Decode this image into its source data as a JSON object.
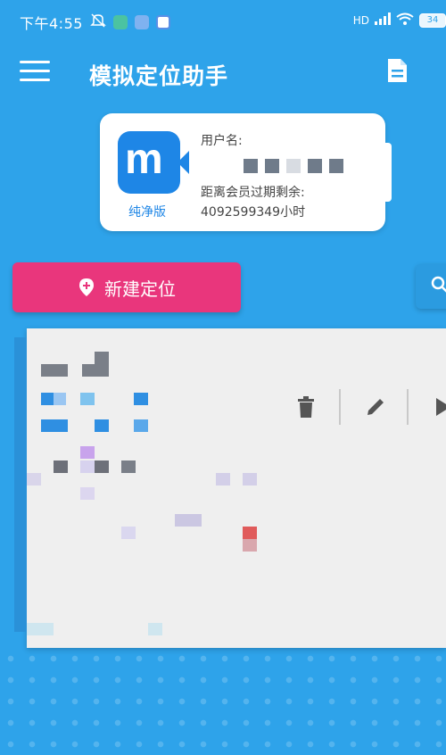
{
  "status_bar": {
    "time": "下午4:55",
    "network": "HD",
    "battery": "34"
  },
  "app_bar": {
    "title": "模拟定位助手",
    "menu_icon": "hamburger-menu-icon",
    "doc_icon": "document-icon"
  },
  "member_card": {
    "badge_label": "纯净版",
    "username_label": "用户名:",
    "expiry_label": "距离会员过期剩余:",
    "expiry_value": "4092599349小时"
  },
  "actions": {
    "new_location_label": "新建定位",
    "new_location_icon": "map-pin-plus-icon",
    "side_icon": "search-icon"
  },
  "location_card": {
    "delete_icon": "trash-icon",
    "edit_icon": "pencil-icon",
    "play_icon": "play-icon"
  },
  "colors": {
    "background": "#2ea3ea",
    "primary_button": "#e9367c",
    "logo": "#1e86e6"
  }
}
